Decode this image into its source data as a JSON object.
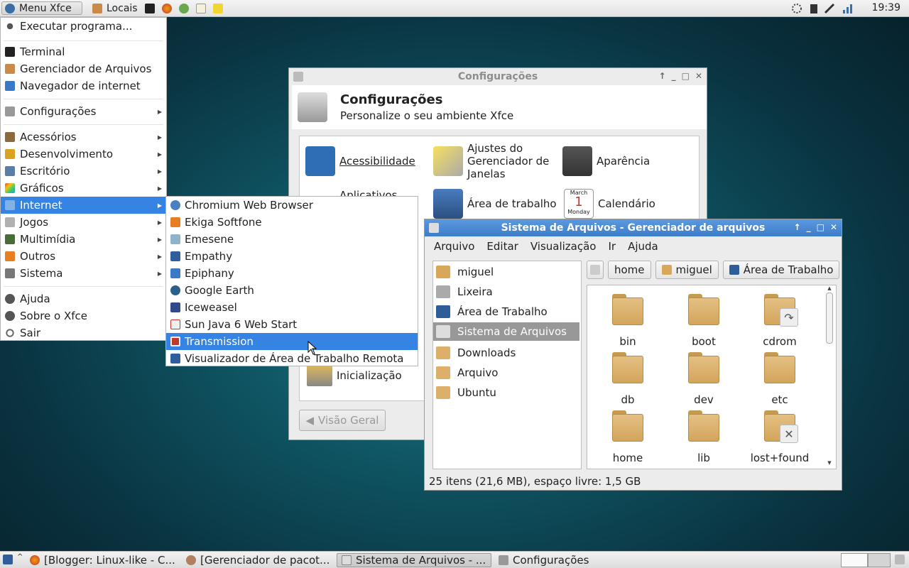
{
  "panel_top": {
    "menu_label": "Menu Xfce",
    "places_label": "Locais",
    "clock": "19:39"
  },
  "menu": {
    "items": [
      {
        "label": "Executar programa...",
        "icon": "gear-icon",
        "has_submenu": false
      },
      {
        "label": "Terminal",
        "icon": "terminal-icon",
        "has_submenu": false
      },
      {
        "label": "Gerenciador de Arquivos",
        "icon": "file-manager-icon",
        "has_submenu": false
      },
      {
        "label": "Navegador de internet",
        "icon": "web-browser-icon",
        "has_submenu": false
      },
      {
        "label": "Configurações",
        "icon": "settings-icon",
        "has_submenu": true
      },
      {
        "label": "Acessórios",
        "icon": "accessories-icon",
        "has_submenu": true
      },
      {
        "label": "Desenvolvimento",
        "icon": "development-icon",
        "has_submenu": true
      },
      {
        "label": "Escritório",
        "icon": "office-icon",
        "has_submenu": true
      },
      {
        "label": "Gráficos",
        "icon": "graphics-icon",
        "has_submenu": true
      },
      {
        "label": "Internet",
        "icon": "internet-icon",
        "has_submenu": true
      },
      {
        "label": "Jogos",
        "icon": "games-icon",
        "has_submenu": true
      },
      {
        "label": "Multimídia",
        "icon": "multimedia-icon",
        "has_submenu": true
      },
      {
        "label": "Outros",
        "icon": "other-icon",
        "has_submenu": true
      },
      {
        "label": "Sistema",
        "icon": "system-icon",
        "has_submenu": true
      },
      {
        "label": "Ajuda",
        "icon": "help-icon",
        "has_submenu": false
      },
      {
        "label": "Sobre o Xfce",
        "icon": "info-icon",
        "has_submenu": false
      },
      {
        "label": "Sair",
        "icon": "logout-icon",
        "has_submenu": false
      }
    ],
    "active": "Internet"
  },
  "submenu": {
    "items": [
      {
        "label": "Chromium Web Browser",
        "icon": "chromium-icon"
      },
      {
        "label": "Ekiga Softfone",
        "icon": "ekiga-icon"
      },
      {
        "label": "Emesene",
        "icon": "emesene-icon"
      },
      {
        "label": "Empathy",
        "icon": "empathy-icon"
      },
      {
        "label": "Epiphany",
        "icon": "epiphany-icon"
      },
      {
        "label": "Google Earth",
        "icon": "google-earth-icon"
      },
      {
        "label": "Iceweasel",
        "icon": "iceweasel-icon"
      },
      {
        "label": "Sun Java 6 Web Start",
        "icon": "java-icon"
      },
      {
        "label": "Transmission",
        "icon": "transmission-icon"
      },
      {
        "label": "Visualizador de Área de Trabalho Remota",
        "icon": "remote-desktop-icon"
      }
    ],
    "active": "Transmission"
  },
  "settings_window": {
    "title": "Configurações",
    "header_title": "Configurações",
    "header_subtitle": "Personalize o seu ambiente Xfce",
    "items": {
      "accessibility": "Acessibilidade",
      "wm_tweaks": "Ajustes do Gerenciador de Janelas",
      "appearance": "Aparência",
      "apps": "Aplicativos",
      "desktop": "Área de trabalho",
      "calendar": "Calendário",
      "calendar_month": "March",
      "calendar_day": "1",
      "calendar_weekday": "Monday",
      "startup": "Inicialização"
    },
    "overview_button": "Visão Geral"
  },
  "file_manager": {
    "title": "Sistema de Arquivos - Gerenciador de arquivos",
    "menubar": [
      "Arquivo",
      "Editar",
      "Visualização",
      "Ir",
      "Ajuda"
    ],
    "sidebar": [
      {
        "label": "miguel",
        "icon": "home-icon"
      },
      {
        "label": "Lixeira",
        "icon": "trash-icon"
      },
      {
        "label": "Área de Trabalho",
        "icon": "desktop-icon"
      },
      {
        "label": "Sistema de Arquivos",
        "icon": "drive-icon"
      },
      {
        "label": "Downloads",
        "icon": "folder-icon"
      },
      {
        "label": "Arquivo",
        "icon": "folder-icon"
      },
      {
        "label": "Ubuntu",
        "icon": "folder-icon"
      }
    ],
    "sidebar_selected": "Sistema de Arquivos",
    "path": [
      "home",
      "miguel",
      "Área de Trabalho"
    ],
    "files": [
      {
        "name": "bin",
        "emblem": ""
      },
      {
        "name": "boot",
        "emblem": ""
      },
      {
        "name": "cdrom",
        "emblem": "↷"
      },
      {
        "name": "db",
        "emblem": ""
      },
      {
        "name": "dev",
        "emblem": ""
      },
      {
        "name": "etc",
        "emblem": ""
      },
      {
        "name": "home",
        "emblem": ""
      },
      {
        "name": "lib",
        "emblem": ""
      },
      {
        "name": "lost+found",
        "emblem": "✕"
      }
    ],
    "status": "25 itens (21,6 MB), espaço livre: 1,5 GB"
  },
  "taskbar": {
    "tasks": [
      {
        "label": "[Blogger: Linux-like - C...",
        "icon": "firefox-icon",
        "active": false
      },
      {
        "label": "[Gerenciador de pacot...",
        "icon": "package-manager-icon",
        "active": false
      },
      {
        "label": "Sistema de Arquivos - ...",
        "icon": "file-manager-icon",
        "active": true
      },
      {
        "label": "Configurações",
        "icon": "settings-icon",
        "active": false
      }
    ]
  },
  "colors": {
    "accent": "#3584e4",
    "desktop_center": "#1f7b86",
    "folder": "#dcb06a"
  }
}
